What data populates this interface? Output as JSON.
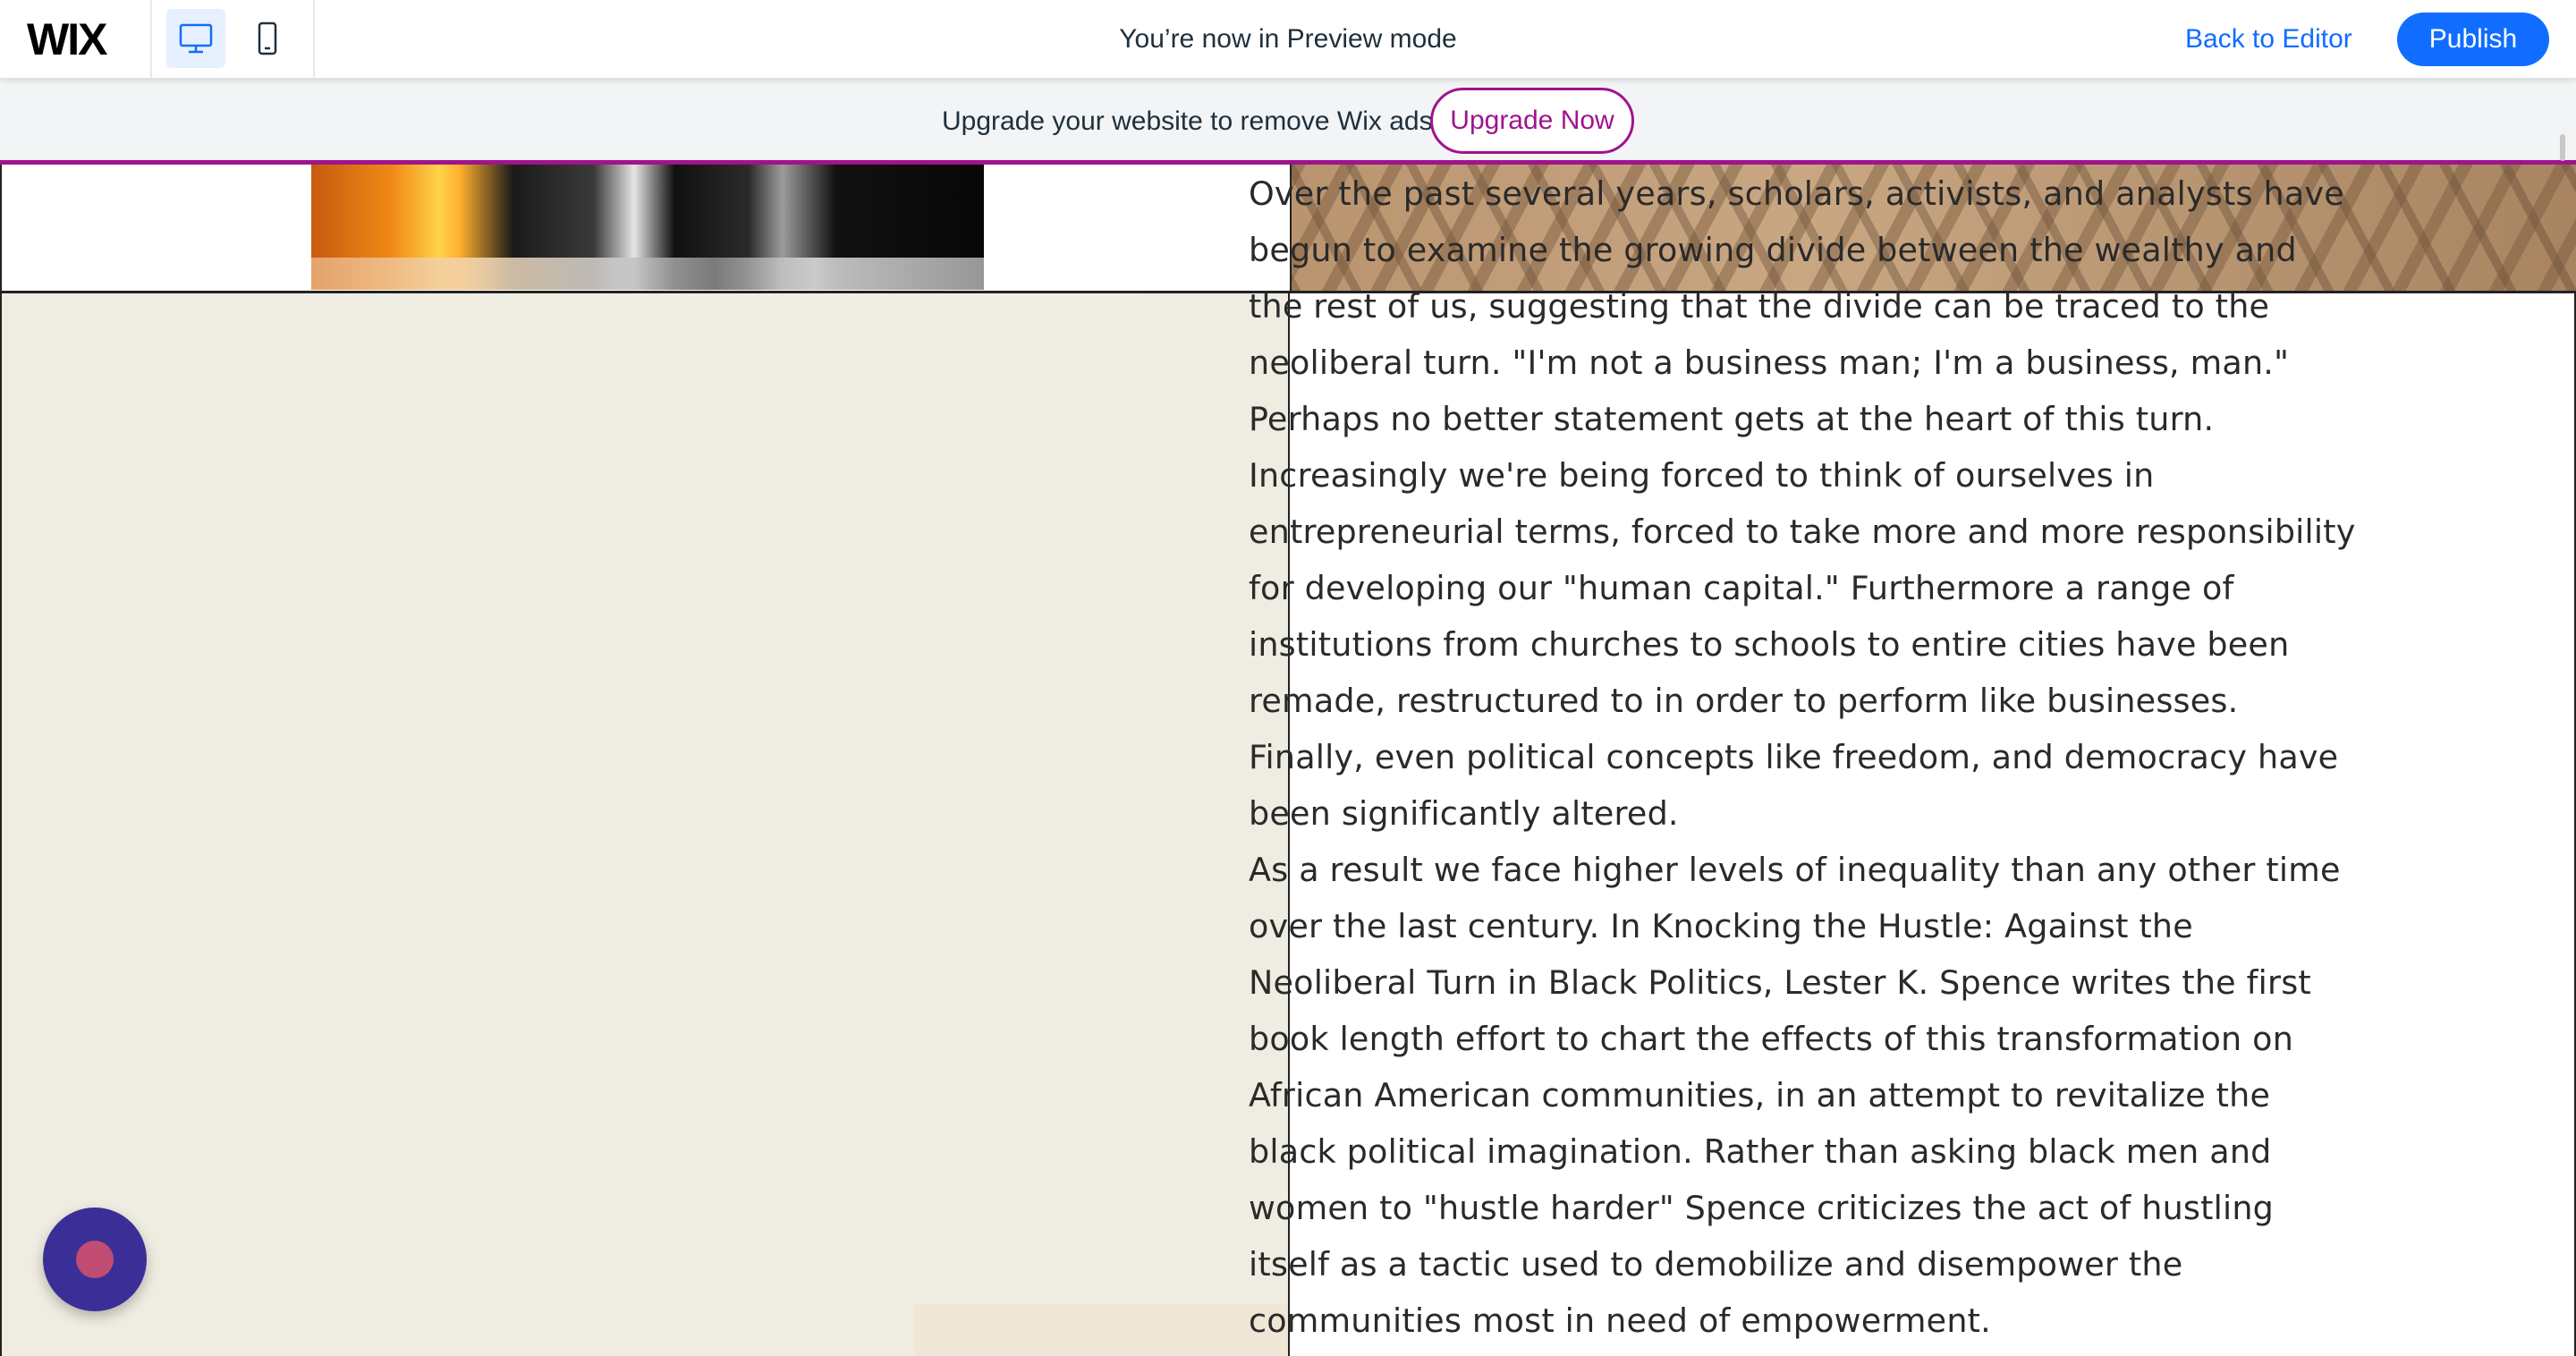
{
  "topbar": {
    "logo": "WIX",
    "preview_text": "You’re now in Preview mode",
    "back_to_editor": "Back to Editor",
    "publish": "Publish",
    "devices": [
      {
        "name": "desktop-icon",
        "active": true
      },
      {
        "name": "mobile-icon",
        "active": false
      }
    ]
  },
  "ad_banner": {
    "text": "Upgrade your website to remove Wix ads",
    "button": "Upgrade Now"
  },
  "colors": {
    "accent_blue": "#116dff",
    "ad_purple": "#a0138e",
    "panel_beige": "#efece1",
    "chat_bubble": "#3b2f97",
    "chat_dot": "#c04b73"
  },
  "article": {
    "paragraph_1": "Over the past several years, scholars, activists, and analysts have begun to examine the growing divide between the wealthy and the rest of us, suggesting that the divide can be traced to the neoliberal turn. \"I'm not a business man; I'm a business, man.\" Perhaps no better statement gets at the heart of this turn. Increasingly we're being forced to think of ourselves in entrepreneurial terms, forced to take more and more responsibility for developing our \"human capital.\" Furthermore a range of institutions from churches to schools to entire cities have been remade, restructured to in order to perform like businesses. Finally, even political concepts like freedom, and democracy have been significantly altered.",
    "paragraph_2": "As a result we face higher levels of inequality than any other time over the last century. In Knocking the Hustle: Against the Neoliberal Turn in Black Politics, Lester K. Spence writes the first book length effort to chart the effects of this transformation on African American communities, in an attempt to revitalize the black political imagination. Rather than asking black men and women to \"hustle harder\" Spence criticizes the act of hustling itself as a tactic used to demobilize and disempower the communities most in need of empowerment."
  },
  "chat": {
    "icon": "chat-icon"
  }
}
